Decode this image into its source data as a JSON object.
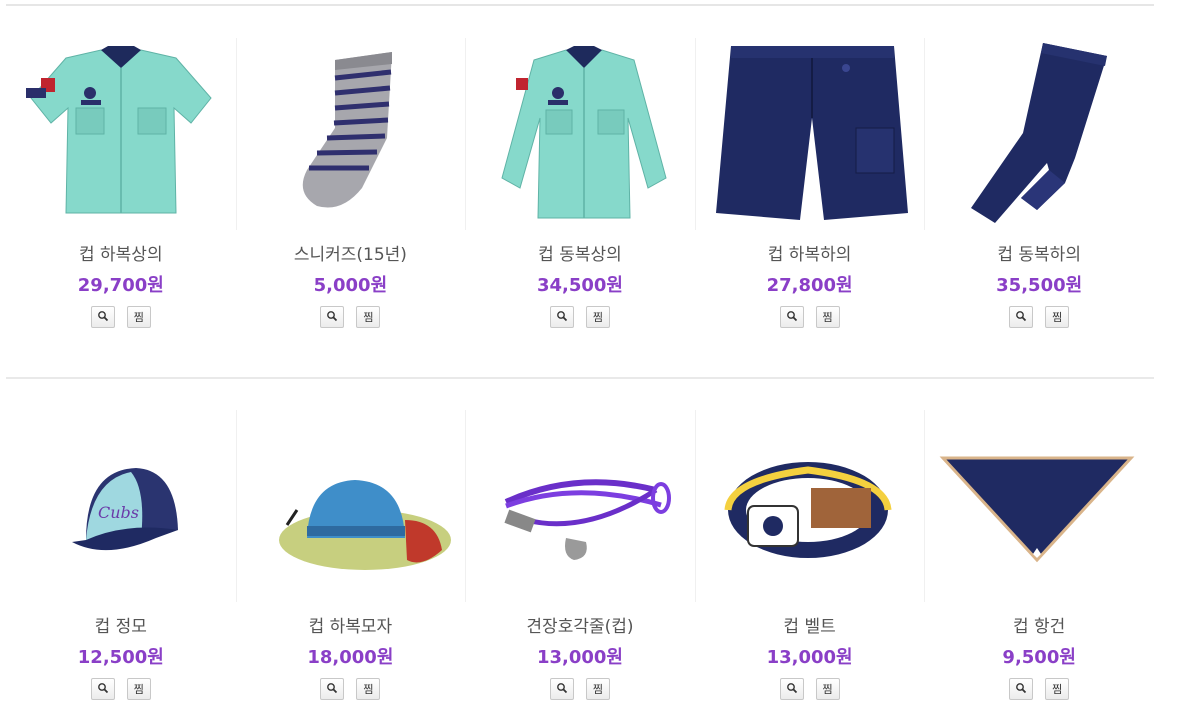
{
  "products": [
    {
      "name": "컵 하복상의",
      "price": "29,700원",
      "image": "short-sleeve-shirt",
      "zoom_icon": "magnifier-icon",
      "wish_label": "찜"
    },
    {
      "name": "스니커즈(15년)",
      "price": "5,000원",
      "image": "striped-sock",
      "zoom_icon": "magnifier-icon",
      "wish_label": "찜"
    },
    {
      "name": "컵 동복상의",
      "price": "34,500원",
      "image": "long-sleeve-shirt",
      "zoom_icon": "magnifier-icon",
      "wish_label": "찜"
    },
    {
      "name": "컵 하복하의",
      "price": "27,800원",
      "image": "navy-shorts",
      "zoom_icon": "magnifier-icon",
      "wish_label": "찜"
    },
    {
      "name": "컵 동복하의",
      "price": "35,500원",
      "image": "navy-pants",
      "zoom_icon": "magnifier-icon",
      "wish_label": "찜"
    },
    {
      "name": "컵 정모",
      "price": "12,500원",
      "image": "baseball-cap",
      "zoom_icon": "magnifier-icon",
      "wish_label": "찜"
    },
    {
      "name": "컵 하복모자",
      "price": "18,000원",
      "image": "bucket-hat",
      "zoom_icon": "magnifier-icon",
      "wish_label": "찜"
    },
    {
      "name": "견장호각줄(컵)",
      "price": "13,000원",
      "image": "whistle-lanyard",
      "zoom_icon": "magnifier-icon",
      "wish_label": "찜"
    },
    {
      "name": "컵 벨트",
      "price": "13,000원",
      "image": "striped-belt",
      "zoom_icon": "magnifier-icon",
      "wish_label": "찜"
    },
    {
      "name": "컵 항건",
      "price": "9,500원",
      "image": "neckerchief",
      "zoom_icon": "magnifier-icon",
      "wish_label": "찜"
    }
  ],
  "colors": {
    "price": "#8a3fc7",
    "mint": "#7ed6c8",
    "navy": "#1e2a5c",
    "purple": "#6a2fc9"
  }
}
